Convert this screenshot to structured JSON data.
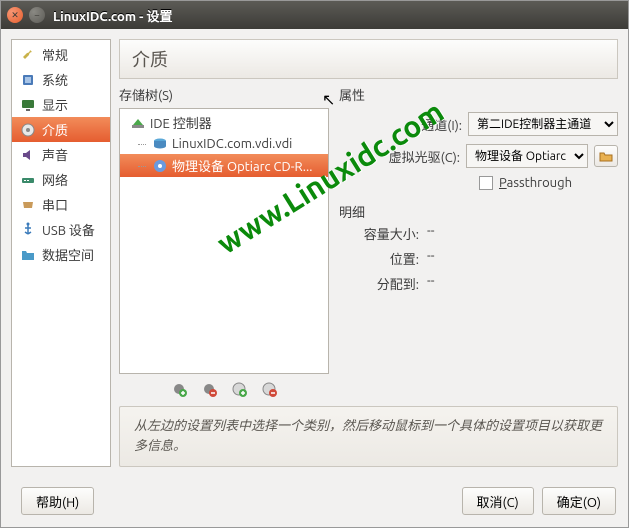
{
  "window": {
    "title": "LinuxIDC.com - 设置"
  },
  "sidebar": {
    "items": [
      {
        "label": "常规"
      },
      {
        "label": "系统"
      },
      {
        "label": "显示"
      },
      {
        "label": "介质"
      },
      {
        "label": "声音"
      },
      {
        "label": "网络"
      },
      {
        "label": "串口"
      },
      {
        "label": "USB 设备"
      },
      {
        "label": "数据空间"
      }
    ]
  },
  "main": {
    "title": "介质",
    "tree_label": "存储树(S)",
    "tree": {
      "controller": "IDE 控制器",
      "items": [
        {
          "label": "LinuxIDC.com.vdi.vdi"
        },
        {
          "label": "物理设备 Optiarc CD-R..."
        }
      ]
    },
    "props": {
      "header": "属性",
      "channel_label": "通道(I):",
      "channel_value": "第二IDE控制器主通道",
      "drive_label": "虚拟光驱(C):",
      "drive_value": "物理设备 Optiarc",
      "passthrough": "Passthrough",
      "detail_header": "明细",
      "capacity_label": "容量大小:",
      "capacity_value": "--",
      "location_label": "位置:",
      "location_value": "--",
      "attached_label": "分配到:",
      "attached_value": "--"
    },
    "hint": "从左边的设置列表中选择一个类别，然后移动鼠标到一个具体的设置项目以获取更多信息。"
  },
  "buttons": {
    "help": "帮助(H)",
    "cancel": "取消(C)",
    "ok": "确定(O)"
  },
  "watermark": "www.Linuxidc.com"
}
